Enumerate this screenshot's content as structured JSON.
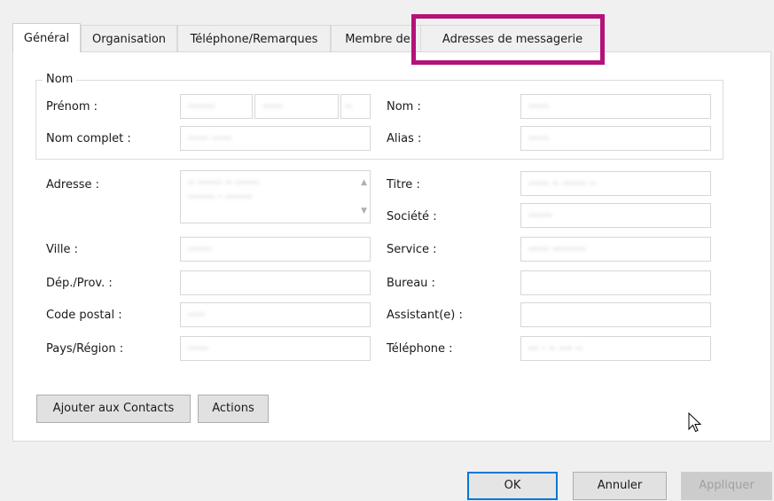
{
  "tabs": [
    {
      "label": "Général",
      "active": true
    },
    {
      "label": "Organisation",
      "active": false
    },
    {
      "label": "Téléphone/Remarques",
      "active": false
    },
    {
      "label": "Membre de",
      "active": false
    },
    {
      "label": "Adresses de messagerie",
      "active": false
    }
  ],
  "name_group": {
    "title": "Nom",
    "prenom_label": "Prénom :",
    "prenom_value": "········",
    "prenom_middle": "······",
    "prenom_initial": "··",
    "nom_complet_label": "Nom complet :",
    "nom_complet_value": "······ ······",
    "nom_label": "Nom :",
    "nom_value": "······",
    "alias_label": "Alias :",
    "alias_value": "······"
  },
  "left_fields": {
    "adresse_label": "Adresse :",
    "adresse_line1": "·· ······· ·· ·······",
    "adresse_line2": "········ · ········",
    "ville_label": "Ville :",
    "ville_value": "·······",
    "dep_label": "Dép./Prov. :",
    "dep_value": "",
    "code_postal_label": "Code postal :",
    "code_postal_value": "·····",
    "pays_label": "Pays/Région :",
    "pays_value": "······"
  },
  "right_fields": {
    "titre_label": "Titre :",
    "titre_value": "······ ·· ······· ··",
    "societe_label": "Société :",
    "societe_value": "·······",
    "service_label": "Service :",
    "service_value": "······ ··········",
    "bureau_label": "Bureau :",
    "bureau_value": "",
    "assistant_label": "Assistant(e) :",
    "assistant_value": "",
    "telephone_label": "Téléphone :",
    "telephone_value": "··· · ·· ···· ··"
  },
  "panel_buttons": {
    "add_contacts": "Ajouter aux Contacts",
    "actions": "Actions"
  },
  "footer_buttons": {
    "ok": "OK",
    "cancel": "Annuler",
    "apply": "Appliquer"
  },
  "icons": {
    "cursor": "mouse-pointer-icon"
  },
  "colors": {
    "highlight": "#b5117a",
    "accent": "#0078d7"
  }
}
